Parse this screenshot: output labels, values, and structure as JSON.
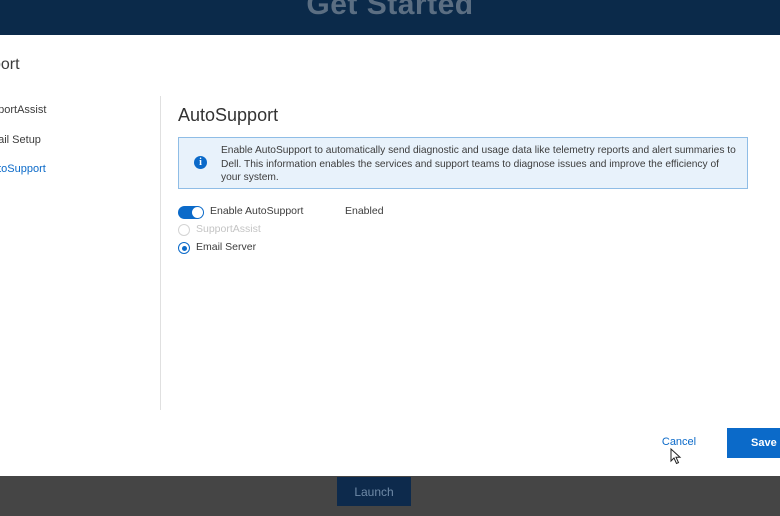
{
  "background": {
    "title": "Get Started",
    "launch_label": "Launch"
  },
  "modal": {
    "title": "port",
    "nav": [
      {
        "label": "pportAssist",
        "active": false
      },
      {
        "label": "nail Setup",
        "active": false
      },
      {
        "label": "utoSupport",
        "active": true
      }
    ],
    "panel": {
      "title": "AutoSupport",
      "info": "Enable AutoSupport to automatically send diagnostic and usage data like telemetry reports and alert summaries to Dell. This information enables the services and support teams to diagnose issues and improve the efficiency of your system.",
      "toggle_label": "Enable AutoSupport",
      "toggle_state": "Enabled",
      "toggle_on": true,
      "options": [
        {
          "label": "SupportAssist",
          "disabled": true,
          "selected": false
        },
        {
          "label": "Email Server",
          "disabled": false,
          "selected": true
        }
      ]
    },
    "footer": {
      "cancel_label": "Cancel",
      "save_label": "Save"
    }
  },
  "colors": {
    "accent": "#0b6ac9",
    "info_bg": "#e8f2fb",
    "header_bg": "#0b2a4a"
  },
  "icons": [
    "info-icon",
    "mouse-pointer-icon"
  ]
}
